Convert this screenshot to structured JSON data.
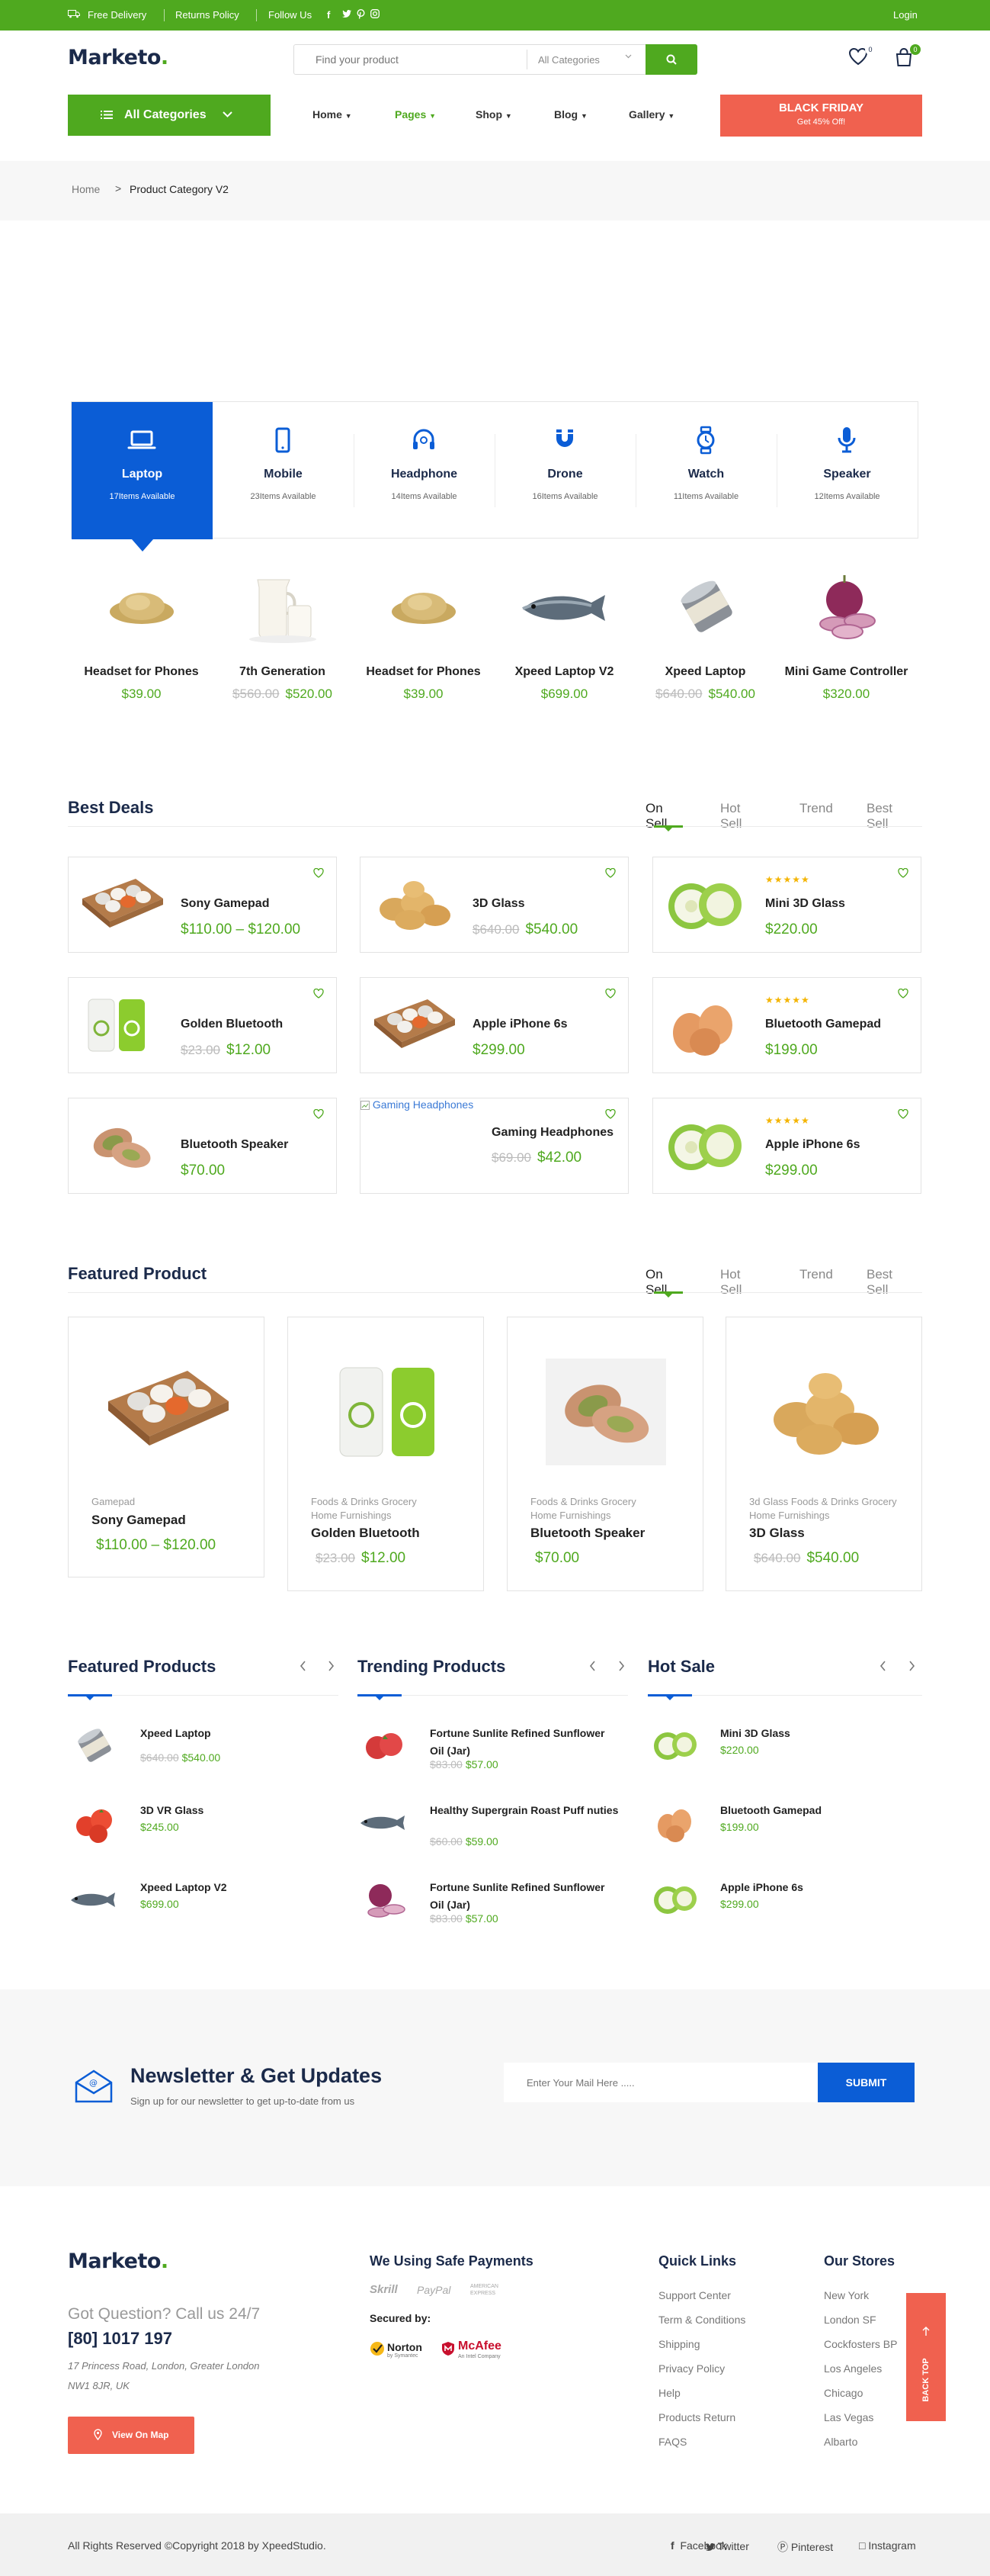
{
  "topbar": {
    "free_delivery": "Free Delivery",
    "returns_policy": "Returns Policy",
    "follow_us": "Follow Us",
    "login": "Login"
  },
  "header": {
    "logo": "Marketo",
    "search_placeholder": "Find your product",
    "search_category": "All Categories",
    "wishlist_count": "0",
    "cart_count": "0"
  },
  "nav": {
    "all_categories": "All Categories",
    "items": [
      "Home",
      "Pages",
      "Shop",
      "Blog",
      "Gallery"
    ],
    "active_color": "#4fa91f",
    "black_friday_title": "BLACK FRIDAY",
    "black_friday_sub": "Get 45% Off!"
  },
  "breadcrumb": {
    "home": "Home",
    "current": "Product Category V2"
  },
  "categories": [
    {
      "name": "Laptop",
      "count": "17Items Available",
      "icon": "laptop-icon"
    },
    {
      "name": "Mobile",
      "count": "23Items Available",
      "icon": "mobile-icon"
    },
    {
      "name": "Headphone",
      "count": "14Items Available",
      "icon": "headphone-icon"
    },
    {
      "name": "Drone",
      "count": "16Items Available",
      "icon": "drone-icon"
    },
    {
      "name": "Watch",
      "count": "11Items Available",
      "icon": "watch-icon"
    },
    {
      "name": "Speaker",
      "count": "12Items Available",
      "icon": "speaker-icon"
    }
  ],
  "category_products": [
    {
      "name": "Headset for Phones",
      "old": "",
      "price": "$39.00"
    },
    {
      "name": "7th Generation",
      "old": "$560.00",
      "price": "$520.00"
    },
    {
      "name": "Headset for Phones",
      "old": "",
      "price": "$39.00"
    },
    {
      "name": "Xpeed Laptop V2",
      "old": "",
      "price": "$699.00"
    },
    {
      "name": "Xpeed Laptop",
      "old": "$640.00",
      "price": "$540.00"
    },
    {
      "name": "Mini Game Controller",
      "old": "",
      "price": "$320.00"
    }
  ],
  "best_deals": {
    "title": "Best Deals",
    "tabs": [
      "On Sell",
      "Hot Sell",
      "Trend",
      "Best Sell"
    ],
    "items": [
      {
        "name": "Sony Gamepad",
        "old": "",
        "price": "$110.00 – $120.00",
        "stars": ""
      },
      {
        "name": "3D Glass",
        "old": "$640.00",
        "price": "$540.00",
        "stars": ""
      },
      {
        "name": "Mini 3D Glass",
        "old": "",
        "price": "$220.00",
        "stars": "★★★★★"
      },
      {
        "name": "Golden Bluetooth",
        "old": "$23.00",
        "price": "$12.00",
        "stars": ""
      },
      {
        "name": "Apple iPhone 6s",
        "old": "",
        "price": "$299.00",
        "stars": ""
      },
      {
        "name": "Bluetooth Gamepad",
        "old": "",
        "price": "$199.00",
        "stars": "★★★★★"
      },
      {
        "name": "Bluetooth Speaker",
        "old": "",
        "price": "$70.00",
        "stars": ""
      },
      {
        "name": "Gaming Headphones",
        "old": "$69.00",
        "price": "$42.00",
        "stars": ""
      },
      {
        "name": "Apple iPhone 6s",
        "old": "",
        "price": "$299.00",
        "stars": "★★★★★"
      }
    ],
    "broken_image_alt": "Gaming Headphones"
  },
  "featured_product": {
    "title": "Featured Product",
    "tabs": [
      "On Sell",
      "Hot Sell",
      "Trend",
      "Best Sell"
    ],
    "items": [
      {
        "cats": [
          "Gamepad"
        ],
        "name": "Sony Gamepad",
        "old": "",
        "price": "$110.00 –  $120.00"
      },
      {
        "cats": [
          "Foods & Drinks Grocery",
          "Home Furnishings"
        ],
        "name": "Golden Bluetooth",
        "old": "$23.00",
        "price": "$12.00"
      },
      {
        "cats": [
          "Foods & Drinks Grocery",
          "Home Furnishings"
        ],
        "name": "Bluetooth Speaker",
        "old": "",
        "price": "$70.00"
      },
      {
        "cats": [
          "3d Glass Foods & Drinks Grocery",
          "Home Furnishings"
        ],
        "name": "3D Glass",
        "old": "$640.00",
        "price": "$540.00"
      }
    ]
  },
  "columns": [
    {
      "title": "Featured Products",
      "items": [
        {
          "name": "Xpeed Laptop",
          "old": "$640.00",
          "price": "$540.00"
        },
        {
          "name": "3D VR Glass",
          "old": "",
          "price": "$245.00"
        },
        {
          "name": "Xpeed Laptop V2",
          "old": "",
          "price": "$699.00"
        }
      ]
    },
    {
      "title": "Trending Products",
      "items": [
        {
          "name": "Fortune Sunlite Refined Sunflower Oil (Jar)",
          "old": "$83.00",
          "price": "$57.00"
        },
        {
          "name": "Healthy Supergrain Roast Puff nuties",
          "old": "$60.00",
          "price": "$59.00"
        },
        {
          "name": "Fortune Sunlite Refined Sunflower Oil (Jar)",
          "old": "$83.00",
          "price": "$57.00"
        }
      ]
    },
    {
      "title": "Hot Sale",
      "items": [
        {
          "name": "Mini 3D Glass",
          "old": "",
          "price": "$220.00"
        },
        {
          "name": "Bluetooth Gamepad",
          "old": "",
          "price": "$199.00"
        },
        {
          "name": "Apple iPhone 6s",
          "old": "",
          "price": "$299.00"
        }
      ]
    }
  ],
  "newsletter": {
    "title": "Newsletter & Get Updates",
    "subtitle": "Sign up for our newsletter to get up-to-date from us",
    "placeholder": "Enter Your Mail Here .....",
    "button": "SUBMIT"
  },
  "footer": {
    "logo": "Marketo",
    "question": "Got Question? Call us 24/7",
    "phone": "[80] 1017 197",
    "address_1": "17 Princess Road, London, Greater London",
    "address_2": "NW1 8JR, UK",
    "map_button": "View On Map",
    "payments_title": "We Using Safe Payments",
    "payments": [
      "Skrill",
      "PayPal",
      "AMERICAN EXPRESS"
    ],
    "secured_by": "Secured by:",
    "security": [
      "Norton",
      "by Symantec",
      "McAfee",
      "An Intel Company"
    ],
    "quick_links_title": "Quick Links",
    "quick_links": [
      "Support Center",
      "Term & Conditions",
      "Shipping",
      "Privacy Policy",
      "Help",
      "Products Return",
      "FAQS"
    ],
    "stores_title": "Our Stores",
    "stores": [
      "New York",
      "London SF",
      "Cockfosters BP",
      "Los Angeles",
      "Chicago",
      "Las Vegas",
      "Albarto"
    ],
    "back_top": "BACK TOP",
    "copyright": "All Rights Reserved ©Copyright 2018 by XpeedStudio.",
    "social": [
      "Facebook",
      "Twitter",
      "Pinterest",
      "Instagram"
    ]
  }
}
